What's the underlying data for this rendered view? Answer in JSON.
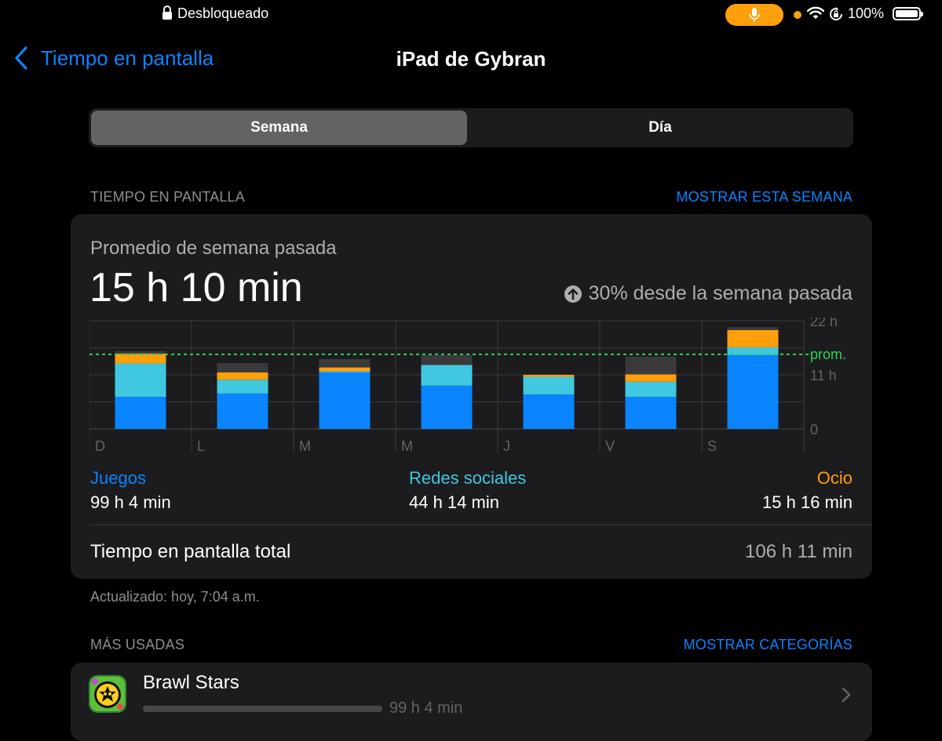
{
  "status_bar": {
    "lock_label": "Desbloqueado",
    "battery": "100%",
    "battery_level": 1.0,
    "icons": [
      "lock-icon",
      "microphone-icon",
      "orange-dot-indicator",
      "wifi-icon",
      "rotation-lock-icon",
      "battery-icon"
    ]
  },
  "nav": {
    "back_label": "Tiempo en pantalla",
    "title": "iPad de Gybran"
  },
  "segments": {
    "week": "Semana",
    "day": "Día",
    "selected": "Semana"
  },
  "screen_time": {
    "section_header": "TIEMPO EN PANTALLA",
    "show_week_link": "MOSTRAR ESTA SEMANA",
    "avg_label": "Promedio de semana pasada",
    "avg_value": "15 h 10 min",
    "trend": "30% desde la semana pasada",
    "categories": [
      {
        "name": "Juegos",
        "value": "99 h 4 min",
        "color": "#0a84ff"
      },
      {
        "name": "Redes sociales",
        "value": "44 h 14 min",
        "color": "#40c8e0"
      },
      {
        "name": "Ocio",
        "value": "15 h 16 min",
        "color": "#ff9f0a"
      }
    ],
    "total_label": "Tiempo en pantalla total",
    "total_value": "106 h 11 min",
    "updated": "Actualizado: hoy, 7:04 a.m."
  },
  "chart_data": {
    "type": "bar",
    "stacked": true,
    "categories": [
      "D",
      "L",
      "M",
      "M",
      "J",
      "V",
      "S"
    ],
    "series": [
      {
        "name": "Juegos",
        "color": "#0a84ff",
        "values": [
          6.5,
          7.2,
          11.5,
          8.8,
          7.0,
          6.5,
          15.0
        ]
      },
      {
        "name": "Redes sociales",
        "color": "#40c8e0",
        "values": [
          6.8,
          2.8,
          0.2,
          4.2,
          3.6,
          3.1,
          1.6
        ]
      },
      {
        "name": "Ocio",
        "color": "#ff9f0a",
        "values": [
          2.0,
          1.5,
          0.8,
          0,
          0.4,
          1.5,
          3.5
        ]
      },
      {
        "name": "",
        "color": "#3a3a3c",
        "values": [
          0.5,
          1.9,
          1.7,
          2.0,
          0.1,
          3.6,
          0.6
        ]
      }
    ],
    "ylim": [
      0,
      22
    ],
    "yticks": [
      "22 h",
      "11 h",
      "0"
    ],
    "average": 15.17,
    "average_label": "prom.",
    "average_color": "#30d158",
    "grid": true
  },
  "most_used": {
    "section_header": "MÁS USADAS",
    "show_categories_link": "MOSTRAR CATEGORÍAS",
    "apps": [
      {
        "name": "Brawl Stars",
        "time": "99 h 4 min",
        "fraction": 1.0
      }
    ]
  }
}
